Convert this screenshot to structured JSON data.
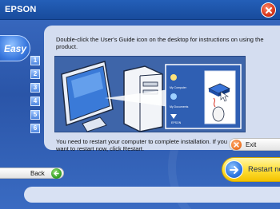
{
  "header": {
    "brand": "EPSON"
  },
  "sidebar": {
    "mode_label": "Easy",
    "steps": [
      "1",
      "2",
      "3",
      "4",
      "5",
      "6"
    ]
  },
  "main": {
    "instructions": "Double-click the User's Guide icon on the desktop for instructions on using the product.",
    "desktop_icons": [
      "My Computer",
      "My Documents",
      "EPSON"
    ],
    "note": "You need to restart your computer to complete installation. If you want to restart now, click Restart."
  },
  "buttons": {
    "exit_label": "Exit",
    "restart_label": "Restart now",
    "back_label": "Back"
  },
  "colors": {
    "background": "#2c57a8",
    "panel": "#d4ddf0",
    "restart_button": "#ffe03a",
    "exit_icon": "#f07a2a",
    "back_icon": "#3aa52a"
  }
}
